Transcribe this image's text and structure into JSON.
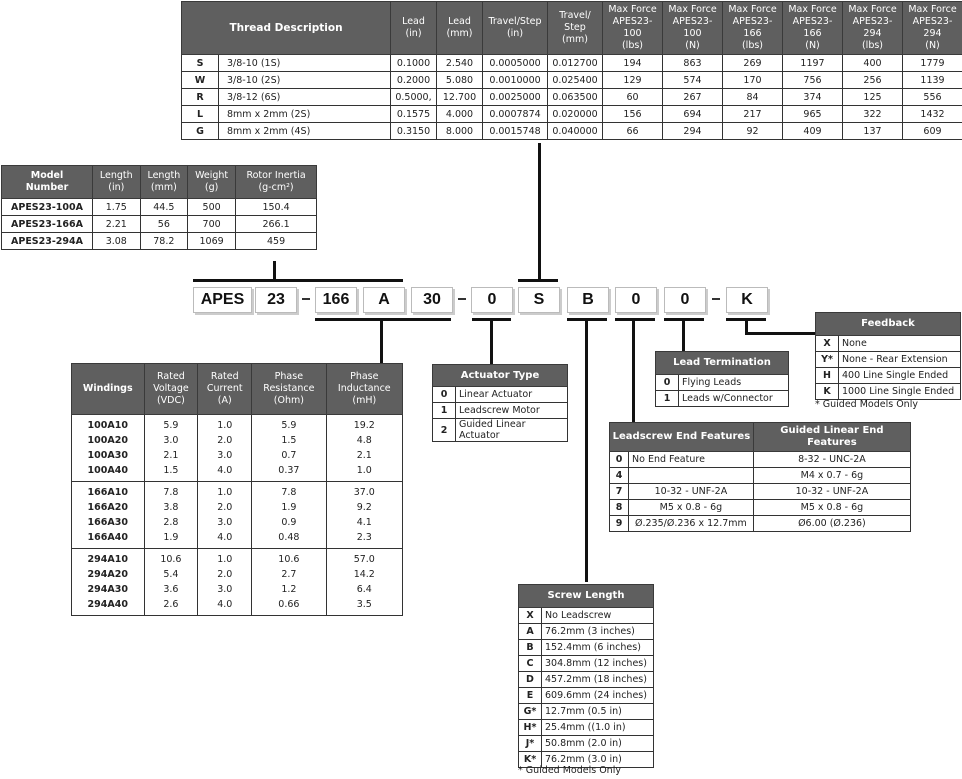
{
  "thread_table": {
    "headers": [
      "Thread Description",
      "Lead\n(in)",
      "Lead\n(mm)",
      "Travel/Step\n(in)",
      "Travel/\nStep\n(mm)",
      "Max Force\nAPES23-100\n(lbs)",
      "Max Force\nAPES23-100\n(N)",
      "Max Force\nAPES23-166\n(lbs)",
      "Max Force\nAPES23-166\n(N)",
      "Max Force\nAPES23-294\n(lbs)",
      "Max Force\nAPES23-294\n(N)"
    ],
    "rows": [
      [
        "S",
        "3/8-10 (1S)",
        "0.1000",
        "2.540",
        "0.0005000",
        "0.012700",
        "194",
        "863",
        "269",
        "1197",
        "400",
        "1779"
      ],
      [
        "W",
        "3/8-10 (2S)",
        "0.2000",
        "5.080",
        "0.0010000",
        "0.025400",
        "129",
        "574",
        "170",
        "756",
        "256",
        "1139"
      ],
      [
        "R",
        "3/8-12 (6S)",
        "0.5000,",
        "12.700",
        "0.0025000",
        "0.063500",
        "60",
        "267",
        "84",
        "374",
        "125",
        "556"
      ],
      [
        "L",
        "8mm x 2mm (2S)",
        "0.1575",
        "4.000",
        "0.0007874",
        "0.020000",
        "156",
        "694",
        "217",
        "965",
        "322",
        "1432"
      ],
      [
        "G",
        "8mm x 2mm (4S)",
        "0.3150",
        "8.000",
        "0.0015748",
        "0.040000",
        "66",
        "294",
        "92",
        "409",
        "137",
        "609"
      ]
    ]
  },
  "model_table": {
    "headers": [
      "Model\nNumber",
      "Length\n(in)",
      "Length\n(mm)",
      "Weight\n(g)",
      "Rotor Inertia\n(g-cm²)"
    ],
    "rows": [
      [
        "APES23-100A",
        "1.75",
        "44.5",
        "500",
        "150.4"
      ],
      [
        "APES23-166A",
        "2.21",
        "56",
        "700",
        "266.1"
      ],
      [
        "APES23-294A",
        "3.08",
        "78.2",
        "1069",
        "459"
      ]
    ]
  },
  "part_number": {
    "segments": [
      "APES",
      "23",
      "166",
      "A",
      "30",
      "0",
      "S",
      "B",
      "0",
      "0",
      "K"
    ],
    "separator": "–"
  },
  "windings_table": {
    "headers": [
      "Windings",
      "Rated\nVoltage\n(VDC)",
      "Rated\nCurrent\n(A)",
      "Phase\nResistance\n(Ohm)",
      "Phase\nInductance\n(mH)"
    ],
    "groups": [
      [
        [
          "100A10",
          "5.9",
          "1.0",
          "5.9",
          "19.2"
        ],
        [
          "100A20",
          "3.0",
          "2.0",
          "1.5",
          "4.8"
        ],
        [
          "100A30",
          "2.1",
          "3.0",
          "0.7",
          "2.1"
        ],
        [
          "100A40",
          "1.5",
          "4.0",
          "0.37",
          "1.0"
        ]
      ],
      [
        [
          "166A10",
          "7.8",
          "1.0",
          "7.8",
          "37.0"
        ],
        [
          "166A20",
          "3.8",
          "2.0",
          "1.9",
          "9.2"
        ],
        [
          "166A30",
          "2.8",
          "3.0",
          "0.9",
          "4.1"
        ],
        [
          "166A40",
          "1.9",
          "4.0",
          "0.48",
          "2.3"
        ]
      ],
      [
        [
          "294A10",
          "10.6",
          "1.0",
          "10.6",
          "57.0"
        ],
        [
          "294A20",
          "5.4",
          "2.0",
          "2.7",
          "14.2"
        ],
        [
          "294A30",
          "3.6",
          "3.0",
          "1.2",
          "6.4"
        ],
        [
          "294A40",
          "2.6",
          "4.0",
          "0.66",
          "3.5"
        ]
      ]
    ]
  },
  "actuator_type": {
    "title": "Actuator Type",
    "rows": [
      [
        "0",
        "Linear Actuator"
      ],
      [
        "1",
        "Leadscrew Motor"
      ],
      [
        "2",
        "Guided Linear Actuator"
      ]
    ]
  },
  "lead_termination": {
    "title": "Lead Termination",
    "rows": [
      [
        "0",
        "Flying Leads"
      ],
      [
        "1",
        "Leads w/Connector"
      ]
    ]
  },
  "feedback": {
    "title": "Feedback",
    "rows": [
      [
        "X",
        "None"
      ],
      [
        "Y*",
        "None - Rear Extension"
      ],
      [
        "H",
        "400 Line Single Ended"
      ],
      [
        "K",
        "1000 Line Single Ended"
      ]
    ],
    "note": "* Guided Models Only"
  },
  "end_features": {
    "headers": [
      "Leadscrew End Features",
      "Guided Linear End Features"
    ],
    "rows": [
      [
        "0",
        "No End Feature",
        "8-32 - UNC-2A"
      ],
      [
        "4",
        "",
        "M4 x 0.7 - 6g"
      ],
      [
        "7",
        "10-32 - UNF-2A",
        "10-32 - UNF-2A"
      ],
      [
        "8",
        "M5 x 0.8 - 6g",
        "M5 x 0.8 - 6g"
      ],
      [
        "9",
        "Ø.235/Ø.236 x 12.7mm",
        "Ø6.00 (Ø.236)"
      ]
    ]
  },
  "screw_length": {
    "title": "Screw Length",
    "rows": [
      [
        "X",
        "No Leadscrew"
      ],
      [
        "A",
        "76.2mm (3 inches)"
      ],
      [
        "B",
        "152.4mm (6 inches)"
      ],
      [
        "C",
        "304.8mm (12 inches)"
      ],
      [
        "D",
        "457.2mm (18 inches)"
      ],
      [
        "E",
        "609.6mm (24 inches)"
      ],
      [
        "G*",
        "12.7mm (0.5 in)"
      ],
      [
        "H*",
        "25.4mm ((1.0 in)"
      ],
      [
        "J*",
        "50.8mm (2.0 in)"
      ],
      [
        "K*",
        "76.2mm (3.0 in)"
      ]
    ],
    "note": "* Guided Models Only"
  }
}
